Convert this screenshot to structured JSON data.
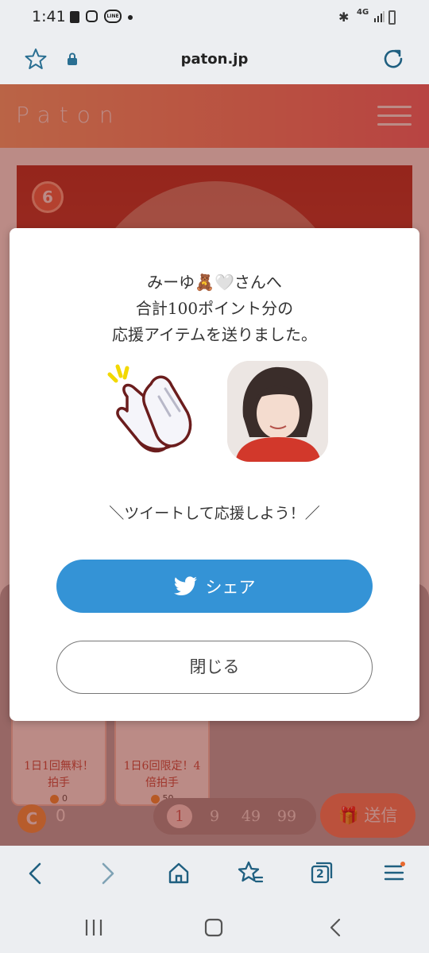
{
  "status_bar": {
    "time": "1:41",
    "line_badge": "LINE",
    "network": "4G"
  },
  "browser": {
    "url": "paton.jp",
    "tab_count": "2"
  },
  "site": {
    "logo": "Paton",
    "rank_badge": "6"
  },
  "items": [
    {
      "name": "1日1回無料！拍手",
      "cost": "0"
    },
    {
      "name": "1日6回限定！4倍拍手",
      "cost": "50"
    }
  ],
  "balance": "0",
  "counts": [
    "1",
    "9",
    "49",
    "99"
  ],
  "send_label": "送信",
  "modal": {
    "line1": "みーゆ🧸🤍さんへ",
    "line2": "合計100ポイント分の",
    "line3": "応援アイテムを送りました。",
    "cta": "＼ツイートして応援しよう！／",
    "share_label": "シェア",
    "close_label": "閉じる"
  },
  "colors": {
    "accent_orange": "#fb8a74",
    "share_blue": "#3493d6"
  }
}
